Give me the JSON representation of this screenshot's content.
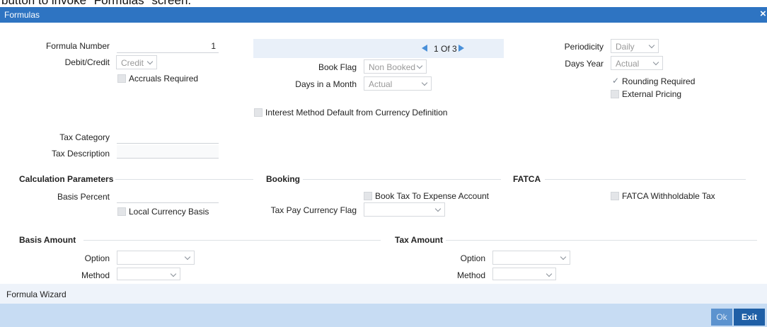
{
  "caption_fragment": "button to invoke \"Formulas\" screen.",
  "window": {
    "title": "Formulas",
    "close_glyph": "×"
  },
  "header": {
    "formula_number_label": "Formula Number",
    "formula_number_value": "1",
    "debit_credit_label": "Debit/Credit",
    "debit_credit_value": "Credit",
    "accruals_required_label": "Accruals Required",
    "accruals_required_checked": false,
    "pager": {
      "text": "1 Of 3"
    },
    "book_flag_label": "Book Flag",
    "book_flag_value": "Non Booked",
    "days_in_month_label": "Days in a Month",
    "days_in_month_value": "Actual",
    "periodicity_label": "Periodicity",
    "periodicity_value": "Daily",
    "days_year_label": "Days Year",
    "days_year_value": "Actual",
    "rounding_required_label": "Rounding Required",
    "rounding_required_checked": true,
    "external_pricing_label": "External Pricing",
    "external_pricing_checked": false,
    "interest_method_label": "Interest Method Default from Currency Definition",
    "interest_method_checked": false,
    "tax_category_label": "Tax Category",
    "tax_category_value": "",
    "tax_description_label": "Tax Description",
    "tax_description_value": ""
  },
  "calculation": {
    "title": "Calculation Parameters",
    "basis_percent_label": "Basis Percent",
    "basis_percent_value": "",
    "local_currency_basis_label": "Local Currency Basis",
    "local_currency_basis_checked": false
  },
  "booking": {
    "title": "Booking",
    "book_tax_label": "Book Tax To Expense Account",
    "book_tax_checked": false,
    "tax_pay_currency_label": "Tax Pay Currency Flag",
    "tax_pay_currency_value": ""
  },
  "fatca": {
    "title": "FATCA",
    "withholdable_label": "FATCA Withholdable Tax",
    "withholdable_checked": false
  },
  "basis_amount": {
    "title": "Basis Amount",
    "option_label": "Option",
    "option_value": "",
    "method_label": "Method",
    "method_value": ""
  },
  "tax_amount": {
    "title": "Tax Amount",
    "option_label": "Option",
    "option_value": "",
    "method_label": "Method",
    "method_value": ""
  },
  "footer": {
    "wizard_label": "Formula Wizard",
    "ok_label": "Ok",
    "exit_label": "Exit"
  },
  "colors": {
    "titlebar": "#2e74c2",
    "exit_button": "#1f5fa6",
    "ok_button": "#5c93cf",
    "footer": "#c7dcf3"
  },
  "icons": {
    "pager_prev": "triangle-left-icon",
    "pager_next": "triangle-right-icon",
    "checkbox_check": "check-icon",
    "dropdown": "chevron-down-icon"
  }
}
